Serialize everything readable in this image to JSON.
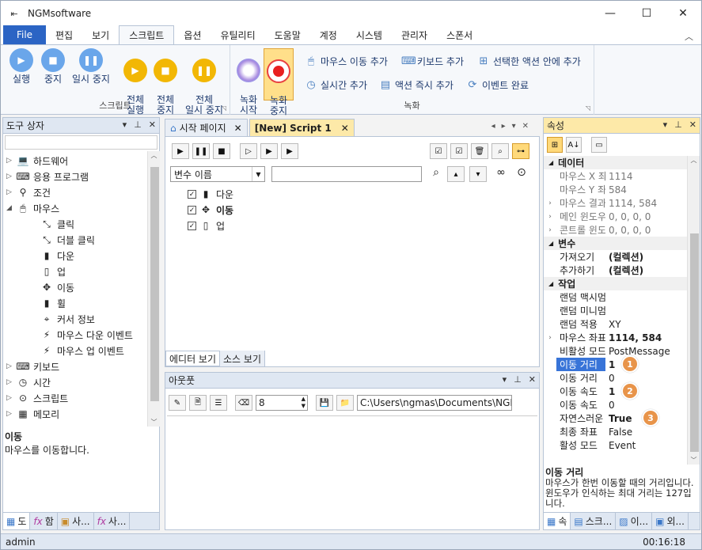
{
  "app": {
    "title": "NGMsoftware"
  },
  "ribbon_tabs": [
    "File",
    "편집",
    "보기",
    "스크립트",
    "옵션",
    "유틸리티",
    "도움말",
    "계정",
    "시스템",
    "관리자",
    "스폰서"
  ],
  "ribbon": {
    "script_group": {
      "label": "스크립트",
      "run": "실행",
      "stop": "중지",
      "pause": "일시 중지",
      "all_run": "전체\n실행",
      "all_stop": "전체\n중지",
      "all_pause": "전체\n일시 중지"
    },
    "record_group": {
      "label": "녹화",
      "start": "녹화\n시작",
      "stop": "녹화\n중지",
      "add_mouse_move": "마우스 이동 추가",
      "add_keyboard": "키보드 추가",
      "add_in_selected": "선택한 액션 안에 추가",
      "add_realtime": "실시간 추가",
      "add_action_now": "액션 즉시 추가",
      "event_done": "이벤트 완료"
    }
  },
  "toolbox": {
    "title": "도구 상자",
    "items": [
      {
        "label": "하드웨어",
        "icon": "laptop-icon",
        "level": 0,
        "arrow": "▷"
      },
      {
        "label": "응용 프로그램",
        "icon": "terminal-icon",
        "level": 0,
        "arrow": "▷"
      },
      {
        "label": "조건",
        "icon": "condition-icon",
        "level": 0,
        "arrow": "▷"
      },
      {
        "label": "마우스",
        "icon": "mouse-icon",
        "level": 0,
        "arrow": "◢"
      },
      {
        "label": "클릭",
        "icon": "click-icon",
        "level": 1
      },
      {
        "label": "더블 클릭",
        "icon": "double-click-icon",
        "level": 1
      },
      {
        "label": "다운",
        "icon": "mouse-down-icon",
        "level": 1
      },
      {
        "label": "업",
        "icon": "mouse-up-icon",
        "level": 1
      },
      {
        "label": "이동",
        "icon": "move-icon",
        "level": 1
      },
      {
        "label": "휠",
        "icon": "wheel-icon",
        "level": 1
      },
      {
        "label": "커서 정보",
        "icon": "cursor-info-icon",
        "level": 1
      },
      {
        "label": "마우스 다운 이벤트",
        "icon": "lightning-icon",
        "level": 1
      },
      {
        "label": "마우스 업 이벤트",
        "icon": "lightning-icon",
        "level": 1
      },
      {
        "label": "키보드",
        "icon": "keyboard-icon",
        "level": 0,
        "arrow": "▷"
      },
      {
        "label": "시간",
        "icon": "clock-icon",
        "level": 0,
        "arrow": "▷"
      },
      {
        "label": "스크립트",
        "icon": "script-icon",
        "level": 0,
        "arrow": "▷"
      },
      {
        "label": "메모리",
        "icon": "memory-icon",
        "level": 0,
        "arrow": "▷"
      },
      {
        "label": "윈도우",
        "icon": "window-icon",
        "level": 0,
        "arrow": "▷"
      }
    ],
    "desc_title": "이동",
    "desc_text": "마우스를 이동합니다.",
    "bottom_tabs": [
      "도",
      "함",
      "사...",
      "사..."
    ]
  },
  "editor": {
    "tabs": [
      {
        "label": "시작 페이지"
      },
      {
        "label": "[New] Script 1"
      }
    ],
    "variable_dropdown": "변수 이름",
    "actions": [
      {
        "label": "다운",
        "icon": "mouse-down-icon",
        "checked": true,
        "bold": false
      },
      {
        "label": "이동",
        "icon": "move-icon",
        "checked": true,
        "bold": true
      },
      {
        "label": "업",
        "icon": "mouse-up-icon",
        "checked": true,
        "bold": false
      }
    ],
    "bottom_tabs": [
      "에디터 보기",
      "소스 보기"
    ]
  },
  "output": {
    "title": "아웃풋",
    "number": "8",
    "path": "C:\\Users\\ngmas\\Documents\\NGM6\\"
  },
  "properties": {
    "title": "속성",
    "categories": [
      {
        "name": "데이터",
        "rows": [
          {
            "name": "마우스 X 좌",
            "value": "1114",
            "dim": true
          },
          {
            "name": "마우스 Y 좌",
            "value": "584",
            "dim": true
          },
          {
            "name": "마우스 결과",
            "value": "1114, 584",
            "dim": true,
            "expand": true
          },
          {
            "name": "메인 윈도우",
            "value": "0, 0, 0, 0",
            "dim": true,
            "expand": true
          },
          {
            "name": "콘트롤 윈도",
            "value": "0, 0, 0, 0",
            "dim": true,
            "expand": true
          }
        ]
      },
      {
        "name": "변수",
        "rows": [
          {
            "name": "가져오기",
            "value": "(컬렉션)",
            "bold": true
          },
          {
            "name": "추가하기",
            "value": "(컬렉션)",
            "bold": true
          }
        ]
      },
      {
        "name": "작업",
        "rows": [
          {
            "name": "랜덤 맥시멈",
            "value": ""
          },
          {
            "name": "랜덤 미니멈",
            "value": ""
          },
          {
            "name": "랜덤 적용",
            "value": "XY"
          },
          {
            "name": "마우스 좌표",
            "value": "1114, 584",
            "bold": true,
            "expand": true
          },
          {
            "name": "비활성 모드",
            "value": "PostMessage"
          },
          {
            "name": "이동 거리",
            "value": "1",
            "bold": true,
            "selected": true
          },
          {
            "name": "이동 거리",
            "value": "0"
          },
          {
            "name": "이동 속도",
            "value": "1",
            "bold": true
          },
          {
            "name": "이동 속도",
            "value": "0"
          },
          {
            "name": "자연스러운",
            "value": "True",
            "bold": true
          },
          {
            "name": "최종 좌표",
            "value": "False"
          },
          {
            "name": "활성 모드",
            "value": "Event"
          }
        ]
      }
    ],
    "badges": [
      "1",
      "2",
      "3"
    ],
    "desc_title": "이동 거리",
    "desc_text": "마우스가 한번 이동할 때의 거리입니다. 윈도우가 인식하는 최대 거리는 127입니다.",
    "bottom_tabs": [
      "속",
      "스크...",
      "이...",
      "외..."
    ]
  },
  "status": {
    "user": "admin",
    "time": "00:16:18"
  }
}
